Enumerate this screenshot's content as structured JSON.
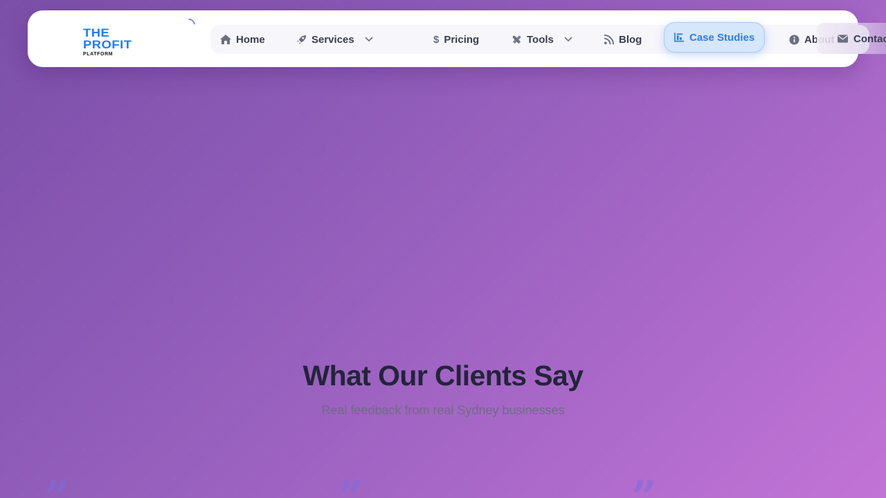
{
  "logo": {
    "line1": "THE",
    "line2": "PROFIT",
    "line3": "PLATFORM"
  },
  "nav": {
    "items": [
      {
        "label": "Home",
        "icon": "home-icon"
      },
      {
        "label": "Services",
        "icon": "rocket-icon",
        "dropdown": true
      },
      {
        "label": "Pricing",
        "icon": "dollar-icon"
      },
      {
        "label": "Tools",
        "icon": "tools-icon",
        "dropdown": true
      },
      {
        "label": "Blog",
        "icon": "blog-icon"
      },
      {
        "label": "Case Studies",
        "icon": "chart-icon",
        "active": true
      },
      {
        "label": "About",
        "icon": "info-icon"
      },
      {
        "label": "Contact",
        "icon": "envelope-icon"
      }
    ]
  },
  "testimonials": {
    "title": "What Our Clients Say",
    "subtitle": "Real feedback from real Sydney businesses",
    "quote_mark": "”"
  },
  "colors": {
    "brand_blue": "#1e7bff",
    "active_tab": "#2f7ee0",
    "heading": "#22253a",
    "background_start": "#7b4fa8",
    "background_end": "#c274d6"
  }
}
